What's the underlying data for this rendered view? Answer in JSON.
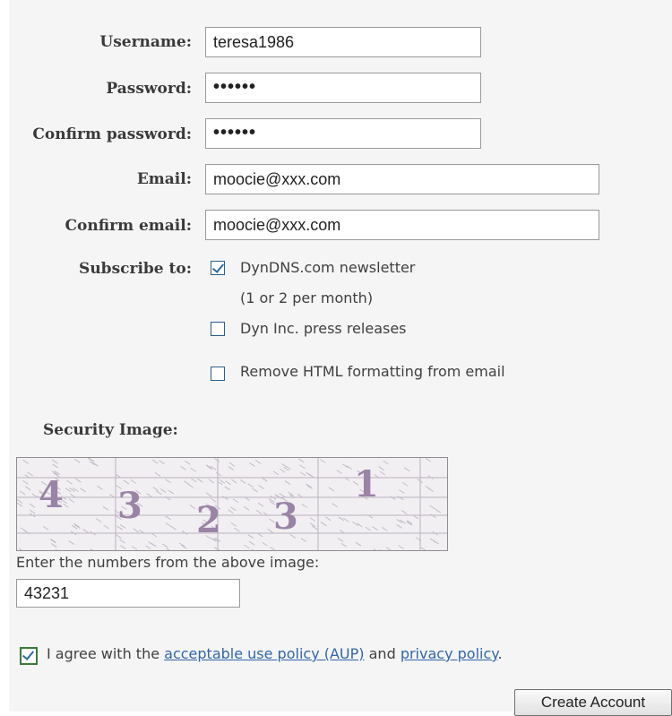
{
  "form": {
    "username_label": "Username:",
    "username_value": "teresa1986",
    "password_label": "Password:",
    "password_value": "••••••",
    "confirm_password_label": "Confirm password:",
    "confirm_password_value": "••••••",
    "email_label": "Email:",
    "email_value": "moocie@xxx.com",
    "confirm_email_label": "Confirm email:",
    "confirm_email_value": "moocie@xxx.com",
    "subscribe_label": "Subscribe to:",
    "options": [
      {
        "label": "DynDNS.com newsletter",
        "checked": true
      },
      {
        "label": "Dyn Inc. press releases",
        "checked": false
      },
      {
        "label": "Remove HTML formatting from email",
        "checked": false
      }
    ],
    "newsletter_note": "(1 or 2 per month)"
  },
  "security": {
    "heading": "Security Image:",
    "captcha_digits": [
      "4",
      "3",
      "2",
      "3",
      "1"
    ],
    "instruction": "Enter the numbers from the above image:",
    "captcha_value": "43231"
  },
  "agreement": {
    "checked": true,
    "prefix": "I agree with the ",
    "aup_link": "acceptable use policy (AUP)",
    "middle": " and ",
    "privacy_link": "privacy policy",
    "suffix": "."
  },
  "actions": {
    "create_account_label": "Create Account"
  },
  "colors": {
    "panel_bg": "#f5f5f5",
    "link": "#3366aa",
    "captcha_digit": "#9a84a6"
  }
}
